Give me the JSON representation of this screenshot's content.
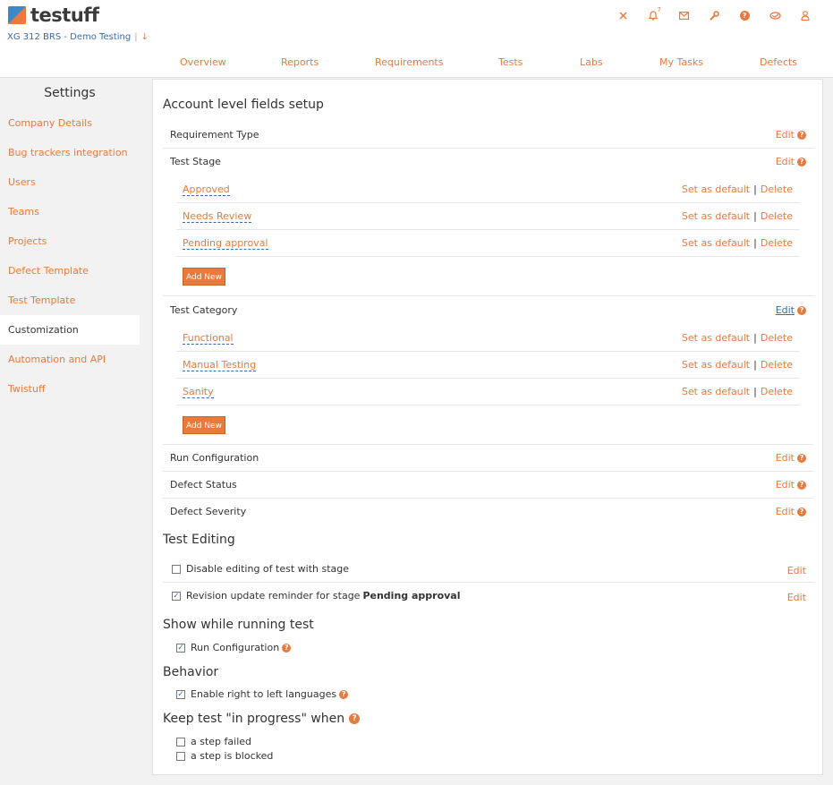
{
  "app": {
    "logo_text": "testuff",
    "project": "XG 312 BRS - Demo Testing",
    "project_sep": "|",
    "project_arrow": "↓"
  },
  "header_icons": [
    {
      "name": "close-icon",
      "glyph": "✕"
    },
    {
      "name": "bell-icon",
      "glyph": "🔔",
      "badge": "7"
    },
    {
      "name": "mail-icon",
      "glyph": "✉"
    },
    {
      "name": "wrench-icon",
      "glyph": "🔧"
    },
    {
      "name": "help-icon",
      "glyph": "?"
    },
    {
      "name": "handshake-icon",
      "glyph": "⚭"
    },
    {
      "name": "user-icon",
      "glyph": "👤"
    }
  ],
  "nav": [
    "Overview",
    "Reports",
    "Requirements",
    "Tests",
    "Labs",
    "My Tasks",
    "Defects"
  ],
  "sidebar": {
    "title": "Settings",
    "items": [
      "Company Details",
      "Bug trackers integration",
      "Users",
      "Teams",
      "Projects",
      "Defect Template",
      "Test Template",
      "Customization",
      "Automation and API",
      "Twistuff"
    ],
    "active_index": 7
  },
  "account_fields": {
    "heading": "Account level fields setup",
    "edit_label": "Edit",
    "set_default_label": "Set as default",
    "delete_label": "Delete",
    "separator": "|",
    "add_new_label": "Add New",
    "requirement_type": "Requirement Type",
    "test_stage": {
      "label": "Test Stage",
      "values": [
        "Approved",
        "Needs Review",
        "Pending approval"
      ]
    },
    "test_category": {
      "label": "Test Category",
      "values": [
        "Functional",
        "Manual Testing",
        "Sanity"
      ]
    },
    "run_configuration": "Run Configuration",
    "defect_status": "Defect Status",
    "defect_severity": "Defect Severity"
  },
  "test_editing": {
    "heading": "Test Editing",
    "edit_label": "Edit",
    "disable_editing": {
      "label": "Disable editing of test with stage",
      "checked": false
    },
    "revision_reminder": {
      "label": "Revision update reminder for stage",
      "stage": "Pending approval",
      "checked": true
    }
  },
  "show_running": {
    "heading": "Show while running test",
    "run_configuration": {
      "label": "Run Configuration",
      "checked": true
    }
  },
  "behavior": {
    "heading": "Behavior",
    "rtl": {
      "label": "Enable right to left languages",
      "checked": true
    }
  },
  "keep_in_progress": {
    "heading": "Keep test \"in progress\" when",
    "step_failed": {
      "label": "a step failed",
      "checked": false
    },
    "step_blocked": {
      "label": "a step is blocked",
      "checked": false
    }
  },
  "colors": {
    "accent": "#e87a3d",
    "link_blue": "#3c6aa8"
  }
}
